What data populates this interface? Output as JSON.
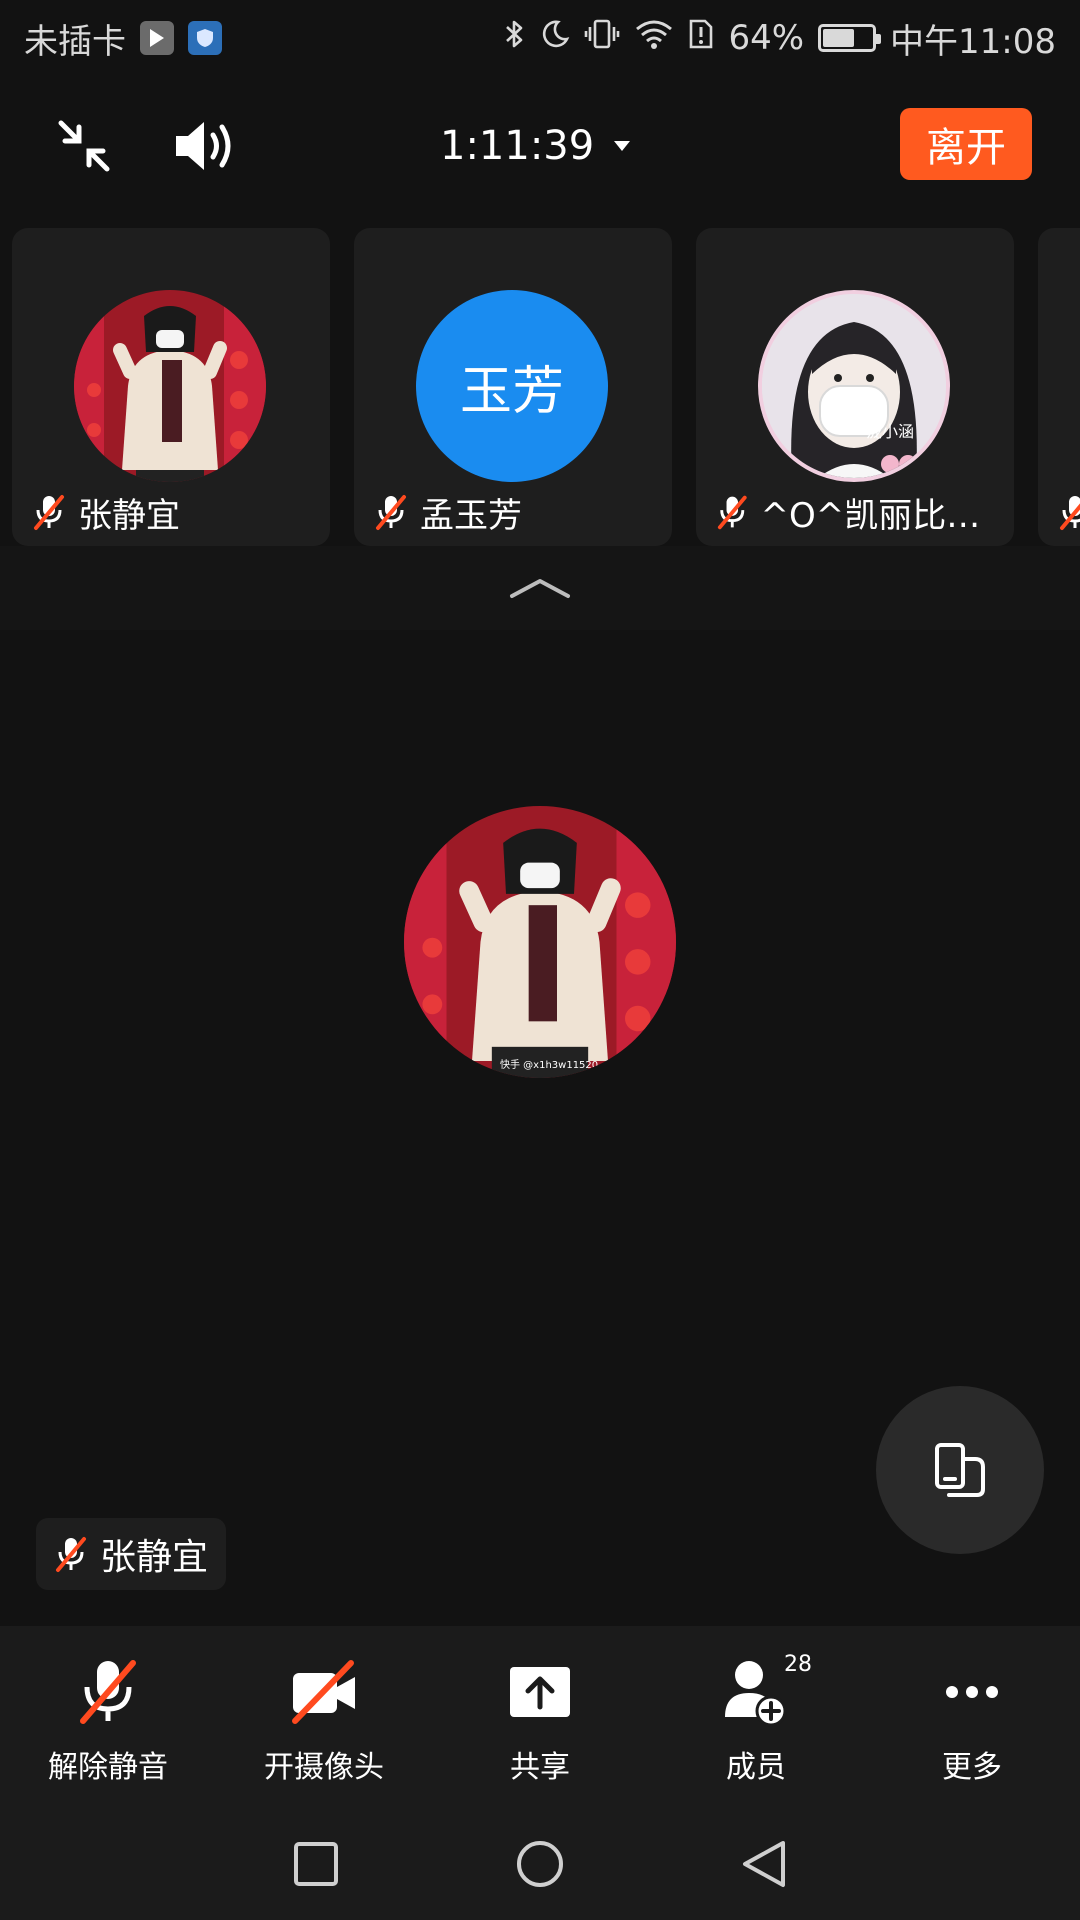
{
  "status_bar": {
    "carrier": "未插卡",
    "battery_text": "64%",
    "battery_level": 0.64,
    "time": "中午11:08"
  },
  "top_bar": {
    "duration": "1:11:39",
    "leave_label": "离开"
  },
  "participants": [
    {
      "name": "张静宜",
      "muted": true,
      "avatar": "photo-girl-red-background"
    },
    {
      "name": "孟玉芳",
      "muted": true,
      "avatar_initials": "玉芳",
      "avatar_color": "#1a8cf0"
    },
    {
      "name": "^O^凯丽比努...",
      "muted": true,
      "avatar": "photo-girl-mask",
      "avatar_caption": "泷小涵"
    }
  ],
  "main": {
    "speaker_name": "张静宜",
    "avatar_watermark": "快手 @x1h3w11520"
  },
  "toolbar": {
    "items": [
      {
        "label": "解除静音",
        "icon": "mic-off-icon"
      },
      {
        "label": "开摄像头",
        "icon": "camera-off-icon"
      },
      {
        "label": "共享",
        "icon": "share-upload-icon"
      },
      {
        "label": "成员",
        "icon": "members-add-icon",
        "badge": "28"
      },
      {
        "label": "更多",
        "icon": "more-dots-icon"
      }
    ]
  },
  "colors": {
    "accent": "#ff5a1f",
    "background": "#121212",
    "tile": "#1e1e1e",
    "initials_avatar": "#1a8cf0"
  }
}
